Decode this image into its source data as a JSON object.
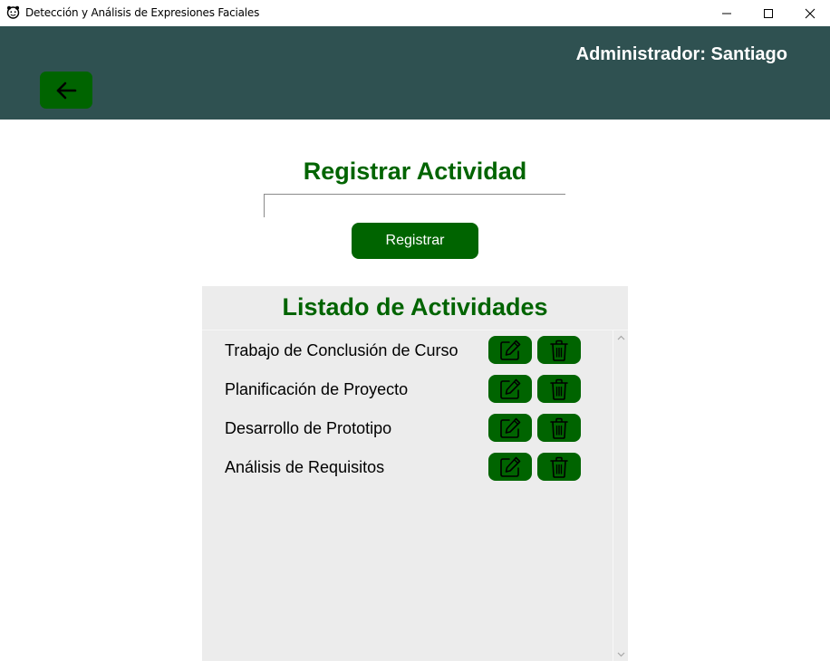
{
  "window": {
    "title": "Detección y Análisis de Expresiones Faciales"
  },
  "header": {
    "admin_label": "Administrador: Santiago",
    "background_color": "#2f5151",
    "back_icon": "arrow-left-icon"
  },
  "register": {
    "title": "Registrar Actividad",
    "input_value": "",
    "input_placeholder": "",
    "button_label": "Registrar"
  },
  "list": {
    "title": "Listado de Actividades",
    "items": [
      {
        "label": "Trabajo de Conclusión de Curso"
      },
      {
        "label": "Planificación de Proyecto"
      },
      {
        "label": "Desarrollo de Prototipo"
      },
      {
        "label": "Análisis de Requisitos"
      }
    ],
    "edit_icon": "pencil-square-icon",
    "delete_icon": "trash-icon"
  },
  "colors": {
    "accent": "#006400",
    "panel": "#ececec",
    "header": "#2f5151",
    "text_on_accent": "#ffffff"
  }
}
